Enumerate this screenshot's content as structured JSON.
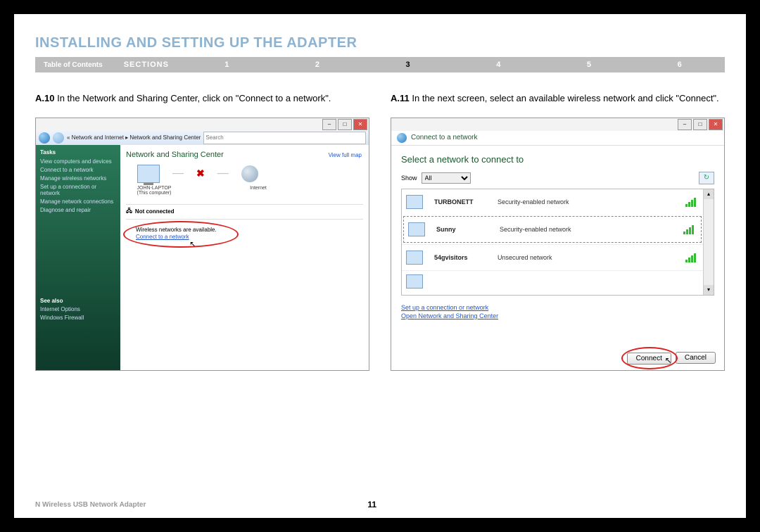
{
  "page_title": "INSTALLING AND SETTING UP THE ADAPTER",
  "nav": {
    "toc": "Table of Contents",
    "sections": "SECTIONS",
    "items": [
      "1",
      "2",
      "3",
      "4",
      "5",
      "6"
    ],
    "active_index": 2
  },
  "left": {
    "step_num": "A.10",
    "step_text": "In the Network and Sharing Center, click on \"Connect to a network\".",
    "breadcrumb": "« Network and Internet  ▸  Network and Sharing Center",
    "search_placeholder": "Search",
    "sidebar": {
      "tasks_hd": "Tasks",
      "links": [
        "View computers and devices",
        "Connect to a network",
        "Manage wireless networks",
        "Set up a connection or network",
        "Manage network connections",
        "Diagnose and repair"
      ],
      "see_also": "See also",
      "see_links": [
        "Internet Options",
        "Windows Firewall"
      ]
    },
    "main": {
      "header": "Network and Sharing Center",
      "full_map": "View full map",
      "pc_label": "JOHN-LAPTOP",
      "pc_sub": "(This computer)",
      "net_label": "Internet",
      "not_connected": "Not connected",
      "avail": "Wireless networks are available.",
      "connect_link": "Connect to a network"
    }
  },
  "right": {
    "step_num": "A.11",
    "step_text": "In the next screen, select an available wireless network and click \"Connect\".",
    "dlg_title": "Connect to a network",
    "header": "Select a network to connect to",
    "show_label": "Show",
    "show_value": "All",
    "networks": [
      {
        "name": "TURBONETT",
        "type": "Security-enabled network",
        "selected": false
      },
      {
        "name": "Sunny",
        "type": "Security-enabled network",
        "selected": true
      },
      {
        "name": "54gvisitors",
        "type": "Unsecured network",
        "selected": false
      }
    ],
    "links": [
      "Set up a connection or network",
      "Open Network and Sharing Center"
    ],
    "connect_btn": "Connect",
    "cancel_btn": "Cancel"
  },
  "footer": {
    "product": "N Wireless USB Network Adapter",
    "page": "11"
  }
}
